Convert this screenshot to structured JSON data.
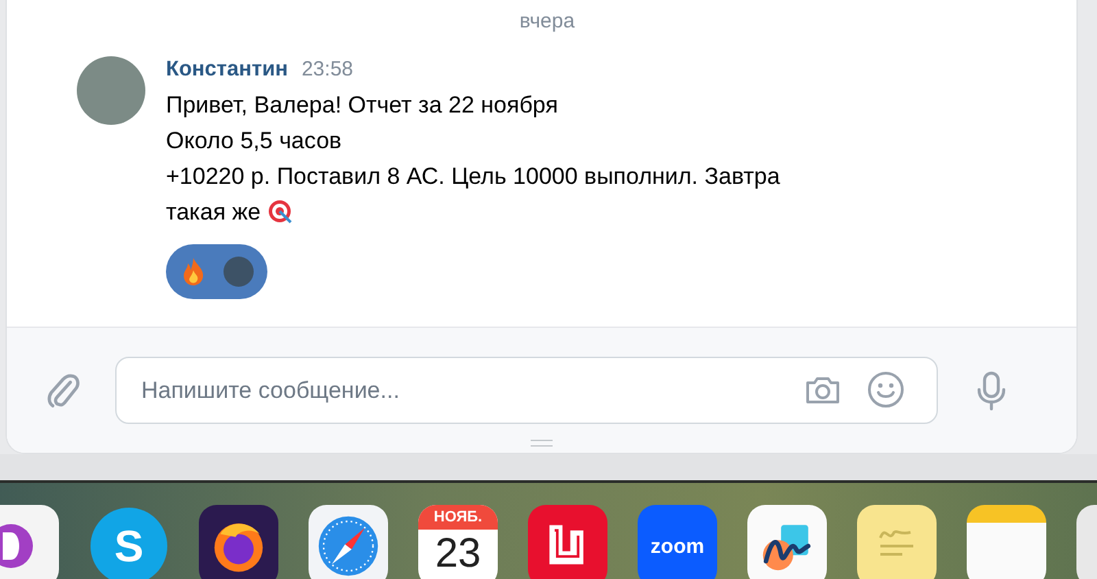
{
  "date_separator": "вчера",
  "message": {
    "author": "Константин",
    "time": "23:58",
    "lines": [
      "Привет, Валера! Отчет за 22 ноября",
      "Около 5,5 часов",
      "+10220 р. Поставил 8 АС. Цель 10000 выполнил. Завтра",
      "такая же"
    ],
    "reactions": [
      {
        "kind": "fire"
      },
      {
        "kind": "photo"
      }
    ]
  },
  "composer": {
    "placeholder": "Напишите сообщение..."
  },
  "dock": [
    {
      "kind": "d-app"
    },
    {
      "kind": "skype",
      "label": "S"
    },
    {
      "kind": "firefox"
    },
    {
      "kind": "safari"
    },
    {
      "kind": "calendar",
      "month": "НОЯБ.",
      "day": "23"
    },
    {
      "kind": "red-app"
    },
    {
      "kind": "zoom",
      "label": "zoom"
    },
    {
      "kind": "freeform"
    },
    {
      "kind": "stickies"
    },
    {
      "kind": "notes"
    },
    {
      "kind": "partial"
    }
  ]
}
